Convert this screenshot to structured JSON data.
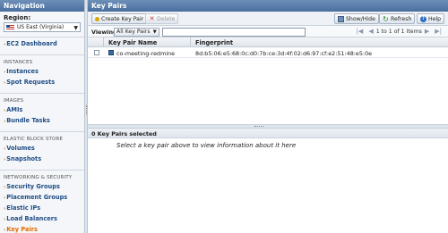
{
  "nav": {
    "header": "Navigation",
    "region_label": "Region:",
    "region_value": "US East (Virginia)",
    "groups": [
      {
        "title": "",
        "items": [
          "EC2 Dashboard"
        ]
      },
      {
        "title": "INSTANCES",
        "items": [
          "Instances",
          "Spot Requests"
        ]
      },
      {
        "title": "IMAGES",
        "items": [
          "AMIs",
          "Bundle Tasks"
        ]
      },
      {
        "title": "ELASTIC BLOCK STORE",
        "items": [
          "Volumes",
          "Snapshots"
        ]
      },
      {
        "title": "NETWORKING & SECURITY",
        "items": [
          "Security Groups",
          "Placement Groups",
          "Elastic IPs",
          "Load Balancers",
          "Key Pairs"
        ]
      }
    ],
    "active_item": "Key Pairs"
  },
  "main": {
    "header": "Key Pairs",
    "toolbar": {
      "create_label": "Create Key Pair",
      "delete_label": "Delete",
      "showhide_label": "Show/Hide",
      "refresh_label": "Refresh",
      "help_label": "Help"
    },
    "viewing": {
      "label": "Viewing:",
      "selected": "All Key Pairs",
      "filter_value": "",
      "pager_text": "1 to 1 of 1 Items"
    },
    "grid": {
      "columns": [
        "Key Pair Name",
        "Fingerprint"
      ],
      "rows": [
        {
          "name": "co-meeting-redmine",
          "fingerprint": "8d:b5:06:e5:68:0c:d0:7b:ce:3d:4f:02:d6:97:cf:e2:51:48:e5:0e"
        }
      ]
    },
    "detail": {
      "header": "0 Key Pairs selected",
      "message": "Select a key pair above to view information about it here"
    }
  },
  "colors": {
    "header_blue": "#4a6f9e",
    "nav_link": "#1f4d85",
    "active_link": "#e66b00"
  }
}
